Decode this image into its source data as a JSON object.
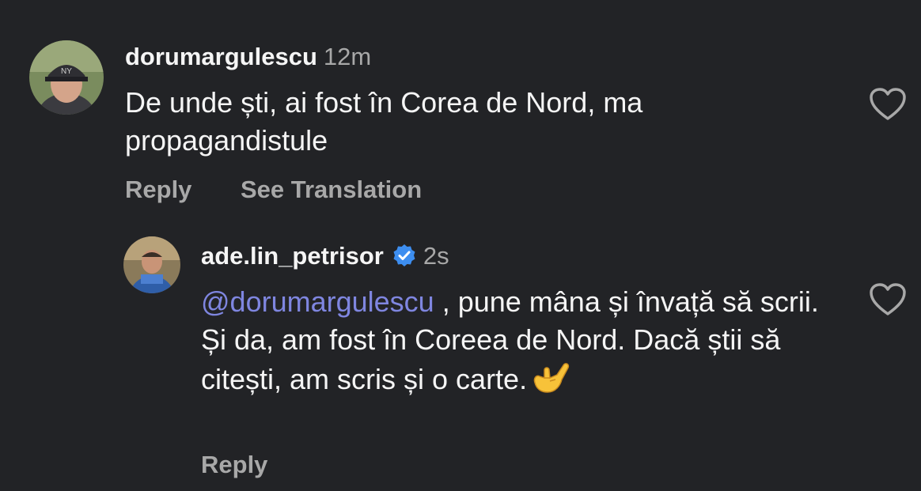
{
  "comments": [
    {
      "username": "dorumargulescu",
      "time": "12m",
      "text": "De unde ști, ai fost în Corea de Nord, ma propagandistule",
      "actions": {
        "reply": "Reply",
        "see_translation": "See Translation"
      },
      "avatar_icon": "user-avatar-cap"
    }
  ],
  "replies": [
    {
      "username": "ade.lin_petrisor",
      "verified": true,
      "time": "2s",
      "mention": "@dorumargulescu",
      "text": " , pune mâna și învață să scrii. Și da, am fost în Coreea de Nord. Dacă știi să citești, am scris și o carte.",
      "emoji_icon": "call-me-hand-emoji",
      "actions": {
        "reply": "Reply"
      }
    }
  ],
  "colors": {
    "background": "#222326",
    "text": "#f5f5f5",
    "muted": "#a8a8a8",
    "mention": "#7f86e0",
    "verified": "#3d8ef0"
  }
}
